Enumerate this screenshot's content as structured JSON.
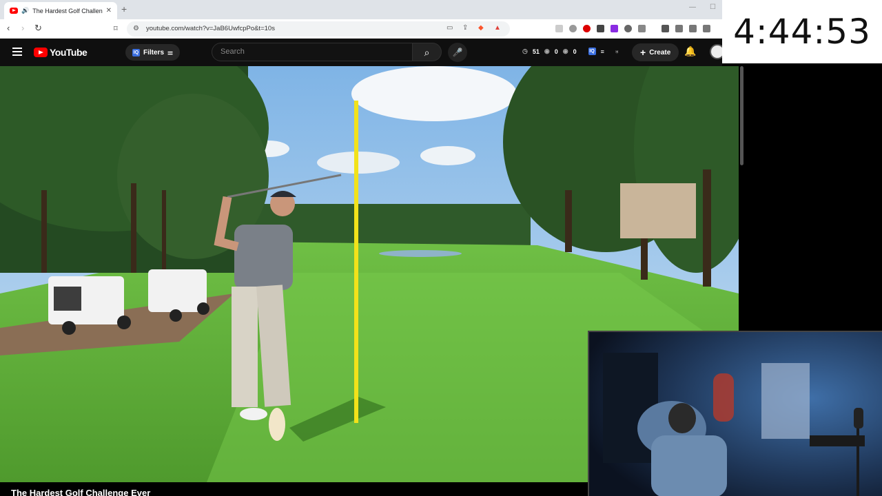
{
  "browser": {
    "tab_title": "The Hardest Golf Challenge E",
    "tab_audio": "🔊",
    "tab_close": "✕",
    "new_tab": "+",
    "url": "youtube.com/watch?v=JaB6UwfcpPo&t=10s",
    "back": "‹",
    "forward": "›",
    "reload": "↻",
    "bookmark": "☐"
  },
  "youtube": {
    "logo_text": "YouTube",
    "filters_label": "Filters",
    "filters_badge": "IQ",
    "search_placeholder": "Search",
    "stats": [
      "51",
      "0",
      "0"
    ],
    "create_label": "Create"
  },
  "video": {
    "title": "The Hardest Golf Challenge Ever"
  },
  "timer": {
    "display": "4:44:53"
  },
  "colors": {
    "youtube_red": "#ff0000",
    "header_bg": "#0f0f0f",
    "flag_yellow": "#f2e21a"
  }
}
